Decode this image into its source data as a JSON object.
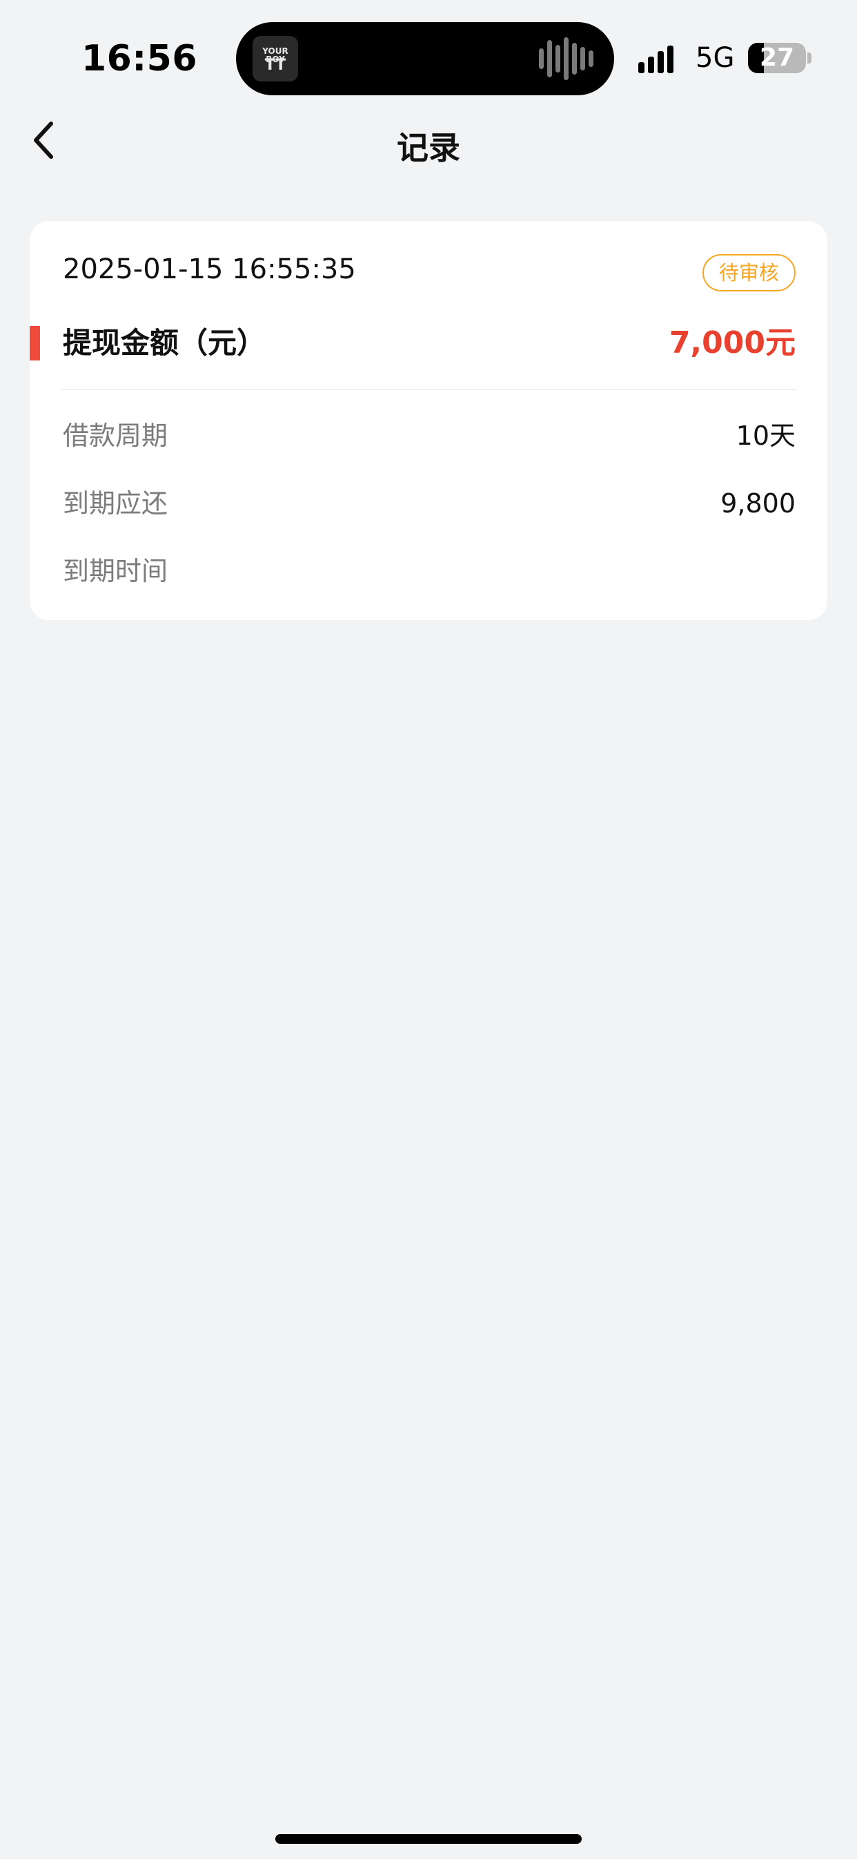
{
  "status_bar": {
    "time": "16:56",
    "network": "5G",
    "battery_level": "27",
    "battery_fraction": 0.27,
    "island_art_line1": "YOUR BOY",
    "island_art_line2": "TT"
  },
  "nav": {
    "back_icon": "chevron-left-icon",
    "title": "记录"
  },
  "record": {
    "datetime": "2025-01-15 16:55:35",
    "status": "待审核",
    "amount_label": "提现金额（元）",
    "amount_value": "7,000元",
    "details": [
      {
        "label": "借款周期",
        "value": "10天"
      },
      {
        "label": "到期应还",
        "value": "9,800"
      },
      {
        "label": "到期时间",
        "value": ""
      }
    ]
  },
  "colors": {
    "background": "#f2f3f5",
    "card": "#ffffff",
    "accent_red": "#e8412f",
    "status_orange": "#f5a623",
    "label_gray": "#7c7c7c"
  }
}
